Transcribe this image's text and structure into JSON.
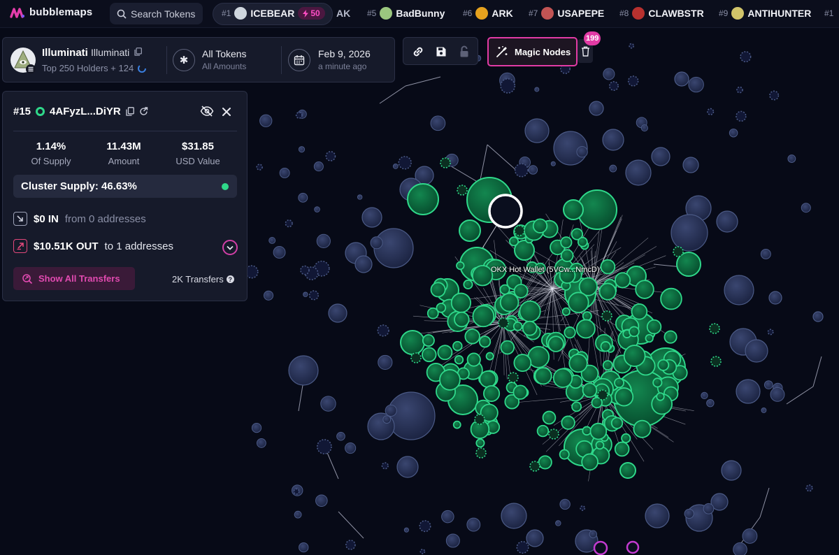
{
  "app": {
    "logo_text": "bubblemaps"
  },
  "search": {
    "label": "Search Tokens"
  },
  "trending": [
    {
      "rank": "#1",
      "name": "ICEBEAR",
      "boost": "50",
      "coin_color": "#cfd6de"
    },
    {
      "rank": "",
      "name": "AK",
      "coin_color": ""
    },
    {
      "rank": "#5",
      "name": "BadBunny",
      "coin_color": "#9bc77f"
    },
    {
      "rank": "#6",
      "name": "ARK",
      "coin_color": "#e6a21e"
    },
    {
      "rank": "#7",
      "name": "USAPEPE",
      "coin_color": "#c25454"
    },
    {
      "rank": "#8",
      "name": "CLAWBSTR",
      "coin_color": "#b8312f"
    },
    {
      "rank": "#9",
      "name": "ANTIHUNTER",
      "coin_color": "#d1c46a"
    },
    {
      "rank": "#1",
      "name": "",
      "coin_color": ""
    }
  ],
  "token": {
    "name": "Illuminati",
    "symbol": "Illuminati",
    "subtitle": "Top 250 Holders + 124",
    "filter_title": "All Tokens",
    "filter_sub": "All Amounts",
    "date": "Feb 9, 2026",
    "date_sub": "a minute ago"
  },
  "toolbar": {
    "magic_label": "Magic Nodes",
    "badge_count": "199"
  },
  "wallet": {
    "rank": "#15",
    "address": "4AFyzL...DiYR",
    "supply_pct": "1.14%",
    "supply_label": "Of Supply",
    "amount": "11.43M",
    "amount_label": "Amount",
    "usd_value": "$31.85",
    "usd_label": "USD Value",
    "cluster_supply": "Cluster Supply: 46.63%",
    "in_amount": "$0 IN",
    "in_text": "from 0 addresses",
    "out_amount": "$10.51K OUT",
    "out_text": "to 1 addresses",
    "show_transfers": "Show All Transfers",
    "transfers_count": "2K Transfers"
  },
  "graph": {
    "hub_label": "OKX Hot Wallet (5VCw...NmcD)",
    "cluster_color": "#2fd88a",
    "bubble_color": "#283355",
    "highlight_color": "#ffffff",
    "magic_color": "#d43bd0"
  }
}
